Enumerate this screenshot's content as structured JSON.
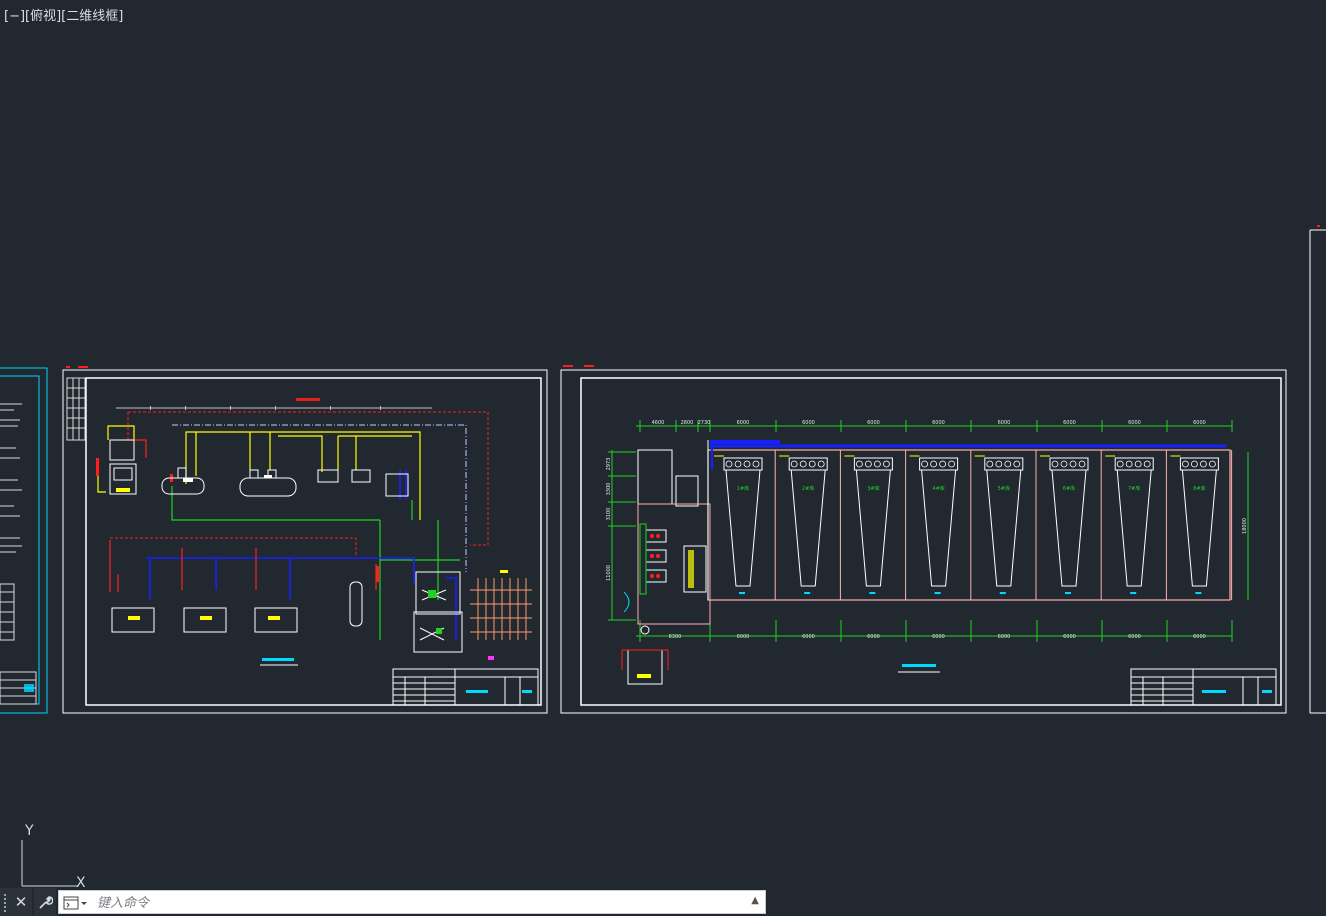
{
  "viewport": {
    "label": "[−][俯视][二维线框]"
  },
  "ucs": {
    "y_label": "Y",
    "x_label": "X"
  },
  "command_line": {
    "placeholder": "键入命令"
  },
  "drawing_right": {
    "top_dims": [
      "4600",
      "2800",
      "2730",
      "6000",
      "6000",
      "6000",
      "6000",
      "6000",
      "6000",
      "6000",
      "6000"
    ],
    "bottom_dims": [
      "8300",
      "6000",
      "6000",
      "6000",
      "6000",
      "6000",
      "6000",
      "6000",
      "6000"
    ],
    "left_dims": [
      "2973",
      "3300",
      "3100",
      "11000"
    ],
    "right_dim": "18000",
    "bays": [
      "1#库",
      "2#库",
      "3#库",
      "4#库",
      "5#库",
      "6#库",
      "7#库",
      "8#库"
    ]
  },
  "colors": {
    "background": "#212830",
    "cyan": "#00d8ff",
    "green": "#1fd31f",
    "red": "#ff1e1e",
    "yellow": "#ffff00",
    "blue": "#1620ff",
    "white": "#ffffff"
  }
}
